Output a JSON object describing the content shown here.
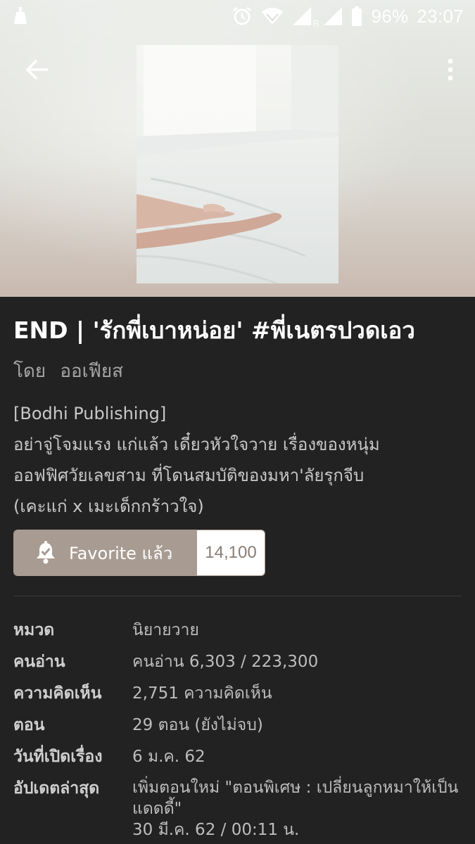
{
  "status_bar": {
    "battery": "96%",
    "time": "23:07",
    "roaming": "R",
    "icons": [
      "cleaner-icon",
      "alarm-icon",
      "wifi-icon",
      "signal-icon",
      "signal-icon",
      "battery-icon"
    ]
  },
  "header": {
    "back_icon": "back-arrow-icon",
    "more_icon": "more-vert-icon"
  },
  "novel": {
    "title": "END | 'รักพี่เบาหน่อย' #พี่เนตรปวดเอว",
    "by_label": "โดย",
    "author": "ออเฟียส",
    "description": " [Bodhi Publishing]\nอย่าจู่โจมแรง แก่แล้ว เดี๋ยวหัวใจวาย เรื่องของหนุ่ม\nออฟฟิศวัยเลขสาม ที่โดนสมบัติของมหา'ลัยรุกจีบ\n(เคะแก่ x เมะเด็กกร้าวใจ)"
  },
  "favorite": {
    "label": "Favorite แล้ว",
    "count": "14,100",
    "icon": "bell-check-icon"
  },
  "info": {
    "rows": [
      {
        "key": "หมวด",
        "value": "นิยายวาย"
      },
      {
        "key": "คนอ่าน",
        "value": "คนอ่าน 6,303 / 223,300"
      },
      {
        "key": "ความคิดเห็น",
        "value": "2,751 ความคิดเห็น"
      },
      {
        "key": "ตอน",
        "value": "29 ตอน (ยังไม่จบ)"
      },
      {
        "key": "วันที่เปิดเรื่อง",
        "value": "6 ม.ค. 62"
      },
      {
        "key": "อัปเดตล่าสุด",
        "value": "เพิ่มตอนใหม่ \"ตอนพิเศษ : เปลี่ยนลูกหมาให้เป็นแดดดี้\"",
        "value2": "30 มี.ค. 62 / 00:11 น."
      }
    ]
  },
  "colors": {
    "background": "#222222",
    "favorite_bg": "#a89b92",
    "text_primary": "#ffffff",
    "text_secondary": "#a6a6a6"
  }
}
